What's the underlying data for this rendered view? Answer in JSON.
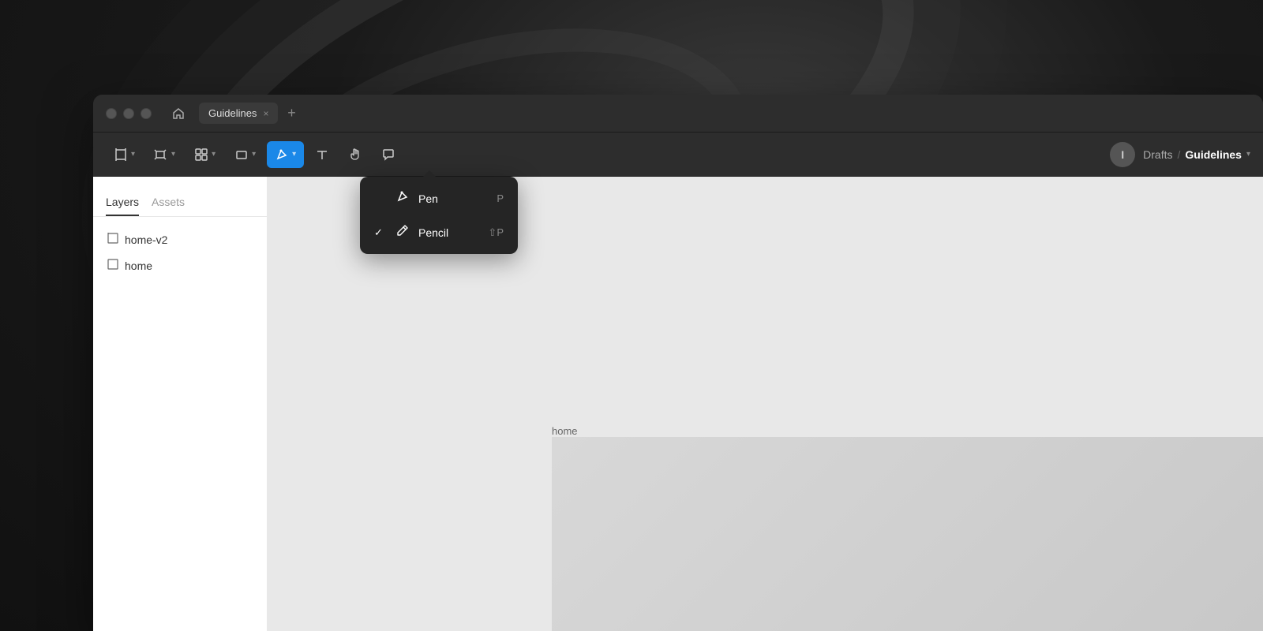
{
  "app": {
    "title": "Guidelines",
    "background_color": "#1a1a1a"
  },
  "title_bar": {
    "tab_label": "Guidelines",
    "tab_close": "×",
    "tab_add": "+",
    "home_icon": "⌂",
    "traffic_lights": [
      "close",
      "minimize",
      "maximize"
    ]
  },
  "toolbar": {
    "tools": [
      {
        "name": "frame-tool",
        "icon": "frame",
        "shortcut": "",
        "has_dropdown": true
      },
      {
        "name": "edit-tool",
        "icon": "edit",
        "shortcut": "",
        "has_dropdown": true
      },
      {
        "name": "grid-tool",
        "icon": "grid",
        "shortcut": "",
        "has_dropdown": true
      },
      {
        "name": "shape-tool",
        "icon": "rect",
        "shortcut": "",
        "has_dropdown": true
      },
      {
        "name": "pen-tool",
        "icon": "pen",
        "shortcut": "",
        "has_dropdown": true,
        "active": true
      },
      {
        "name": "text-tool",
        "icon": "text",
        "has_dropdown": false
      },
      {
        "name": "hand-tool",
        "icon": "hand",
        "has_dropdown": false
      },
      {
        "name": "comment-tool",
        "icon": "comment",
        "has_dropdown": false
      }
    ],
    "breadcrumb": {
      "drafts": "Drafts",
      "separator": "/",
      "current": "Guidelines"
    },
    "user_initial": "I"
  },
  "sidebar": {
    "tabs": [
      {
        "label": "Layers",
        "active": true
      },
      {
        "label": "Assets",
        "active": false
      }
    ],
    "layers": [
      {
        "name": "home-v2",
        "type": "frame"
      },
      {
        "name": "home",
        "type": "frame"
      }
    ]
  },
  "dropdown": {
    "items": [
      {
        "label": "Pen",
        "shortcut": "P",
        "checked": false,
        "icon": "pen"
      },
      {
        "label": "Pencil",
        "shortcut": "⇧P",
        "checked": true,
        "icon": "pencil"
      }
    ]
  },
  "canvas": {
    "frame_label": "home",
    "bg_color": "#e8e8e8"
  }
}
